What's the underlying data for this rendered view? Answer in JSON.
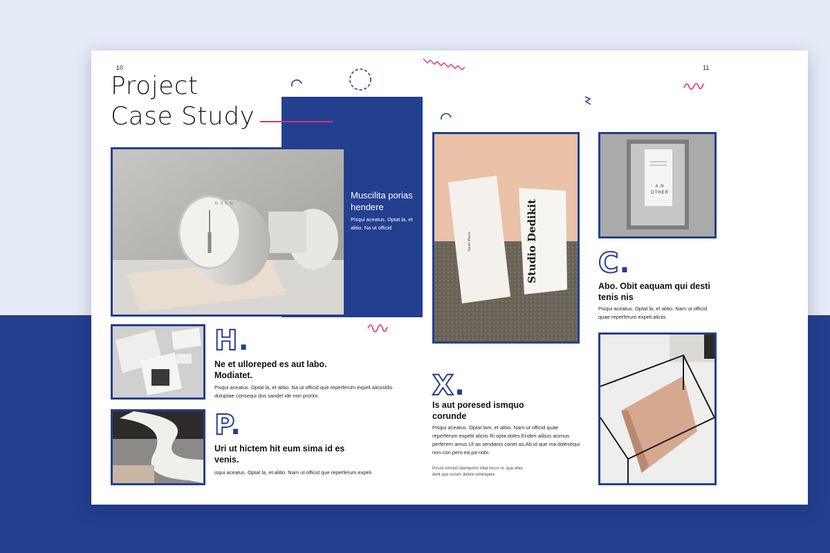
{
  "pages": {
    "left": "10",
    "right": "11"
  },
  "title": {
    "line1": "Project",
    "line2": "Case Study"
  },
  "feature": {
    "title": "Muscilita porias hendere",
    "body": "Pisqui aceatus. Optat la, et alitio. Na ut officid"
  },
  "sections": {
    "h": {
      "letter": "H",
      "title": "Ne et ulloreped es aut labo. Modiatet.",
      "body": "Pisqui aceatus. Optat la, et alitio. Na ut officid que reperferum expeli aliciisldis doluptae consequi dus sandel ide non prorior."
    },
    "p": {
      "letter": "P",
      "title": "Uri ut hictem hit eum sima id es venis.",
      "body": "isqui aceatus. Optat la, et alitio. Nam ut officid que reperferum expeli"
    },
    "x": {
      "letter": "X",
      "title": "Is aut poresed ismquo corunde",
      "body": "Pisqui aceatus. Optat lam, et alitio. Nam ut officid quae reperferum expelit aliciis Ri opta doles.Enderi alibus acimus perferem amus.Ut as sendanis conet as.Ab id que ma dolesequi non con pero ea pa nobi.",
      "note": "Possit omnisti istemporro totat recus re. que elles dent quo iscium dolore volorepere"
    },
    "c": {
      "letter": "C",
      "title": "Abo. Obit eaquam qui desti tenis nis",
      "body": "Pisqui aceatus. Optat la, et alitio. Nam ut officid quae reperferum expeli aliciis"
    }
  },
  "mockups": {
    "clock_brand": "DSEN",
    "card_brand": "Studio Dedikit",
    "card_name": "Sarah Moore",
    "box_label": "A.N OTHER"
  },
  "colors": {
    "accent": "#233f8f",
    "pink": "#e0306e"
  }
}
